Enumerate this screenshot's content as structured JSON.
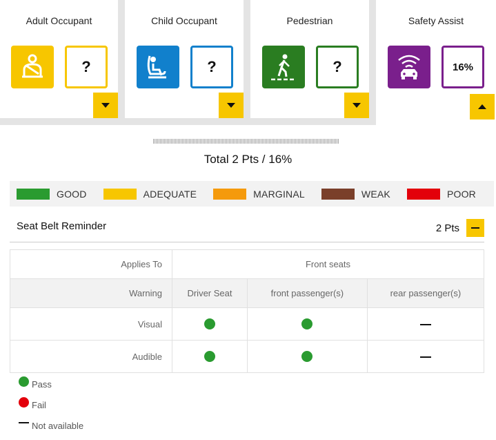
{
  "categories": [
    {
      "title": "Adult Occupant",
      "score": "?",
      "color": "#f7c600",
      "icon": "seated-adult-icon",
      "toggle": "down"
    },
    {
      "title": "Child Occupant",
      "score": "?",
      "color": "#1180cc",
      "icon": "child-seat-icon",
      "toggle": "down"
    },
    {
      "title": "Pedestrian",
      "score": "?",
      "color": "#2a7d21",
      "icon": "pedestrian-crossing-icon",
      "toggle": "down"
    },
    {
      "title": "Safety Assist",
      "score": "16%",
      "color": "#7a1f8c",
      "icon": "car-sensor-icon",
      "toggle": "up"
    }
  ],
  "total": "Total 2 Pts / 16%",
  "legend": [
    {
      "label": "GOOD",
      "color": "#2a9b30"
    },
    {
      "label": "ADEQUATE",
      "color": "#f7c600"
    },
    {
      "label": "MARGINAL",
      "color": "#f59a0c"
    },
    {
      "label": "WEAK",
      "color": "#7a3f2a"
    },
    {
      "label": "POOR",
      "color": "#e3000b"
    }
  ],
  "section": {
    "title": "Seat Belt Reminder",
    "points": "2 Pts"
  },
  "table": {
    "applies_label": "Applies To",
    "applies_value": "Front seats",
    "warning_label": "Warning",
    "columns": [
      "Driver Seat",
      "front passenger(s)",
      "rear passenger(s)"
    ],
    "rows": [
      {
        "label": "Visual",
        "values": [
          "pass",
          "pass",
          "na"
        ]
      },
      {
        "label": "Audible",
        "values": [
          "pass",
          "pass",
          "na"
        ]
      }
    ]
  },
  "key": {
    "pass": "Pass",
    "fail": "Fail",
    "na": "Not available",
    "pass_color": "#2a9b30",
    "fail_color": "#e3000b"
  }
}
